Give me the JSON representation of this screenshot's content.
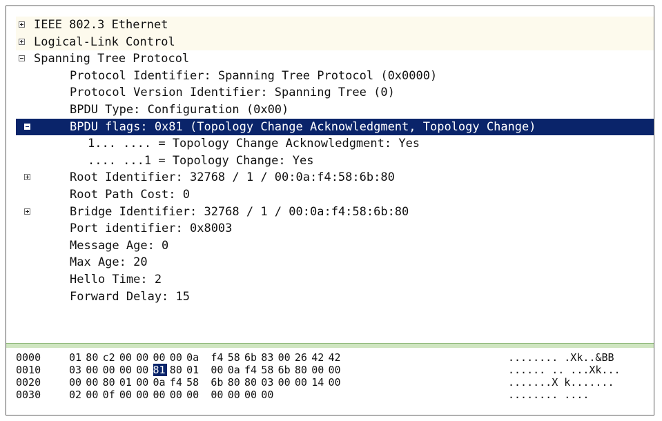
{
  "tree": [
    {
      "text": "IEEE 802.3 Ethernet",
      "indent": 0,
      "toggle": "plus",
      "style": "cream"
    },
    {
      "text": "Logical-Link Control",
      "indent": 0,
      "toggle": "plus",
      "style": "cream"
    },
    {
      "text": "Spanning Tree Protocol",
      "indent": 0,
      "toggle": "minus",
      "style": ""
    },
    {
      "text": "Protocol Identifier: Spanning Tree Protocol (0x0000)",
      "indent": 1,
      "toggle": "",
      "style": ""
    },
    {
      "text": "Protocol Version Identifier: Spanning Tree (0)",
      "indent": 1,
      "toggle": "",
      "style": ""
    },
    {
      "text": "BPDU Type: Configuration (0x00)",
      "indent": 1,
      "toggle": "",
      "style": ""
    },
    {
      "text": "BPDU flags: 0x81 (Topology Change Acknowledgment, Topology Change)",
      "indent": 1,
      "toggle": "minus",
      "style": "selected"
    },
    {
      "text": "1... .... = Topology Change Acknowledgment: Yes",
      "indent": 2,
      "toggle": "",
      "style": ""
    },
    {
      "text": ".... ...1 = Topology Change: Yes",
      "indent": 2,
      "toggle": "",
      "style": ""
    },
    {
      "text": "Root Identifier: 32768 / 1 / 00:0a:f4:58:6b:80",
      "indent": 1,
      "toggle": "plus",
      "style": ""
    },
    {
      "text": "Root Path Cost: 0",
      "indent": 1,
      "toggle": "",
      "style": ""
    },
    {
      "text": "Bridge Identifier: 32768 / 1 / 00:0a:f4:58:6b:80",
      "indent": 1,
      "toggle": "plus",
      "style": ""
    },
    {
      "text": "Port identifier: 0x8003",
      "indent": 1,
      "toggle": "",
      "style": ""
    },
    {
      "text": "Message Age: 0",
      "indent": 1,
      "toggle": "",
      "style": ""
    },
    {
      "text": "Max Age: 20",
      "indent": 1,
      "toggle": "",
      "style": ""
    },
    {
      "text": "Hello Time: 2",
      "indent": 1,
      "toggle": "",
      "style": ""
    },
    {
      "text": "Forward Delay: 15",
      "indent": 1,
      "toggle": "",
      "style": ""
    }
  ],
  "hex": [
    {
      "offset": "0000",
      "bytes": [
        "01",
        "80",
        "c2",
        "00",
        "00",
        "00",
        "00",
        "0a",
        "f4",
        "58",
        "6b",
        "83",
        "00",
        "26",
        "42",
        "42"
      ],
      "ascii": "........ .Xk..&BB",
      "sel": -1
    },
    {
      "offset": "0010",
      "bytes": [
        "03",
        "00",
        "00",
        "00",
        "00",
        "81",
        "80",
        "01",
        "00",
        "0a",
        "f4",
        "58",
        "6b",
        "80",
        "00",
        "00"
      ],
      "ascii": "...... .. ...Xk...",
      "sel": 5
    },
    {
      "offset": "0020",
      "bytes": [
        "00",
        "00",
        "80",
        "01",
        "00",
        "0a",
        "f4",
        "58",
        "6b",
        "80",
        "80",
        "03",
        "00",
        "00",
        "14",
        "00"
      ],
      "ascii": ".......X k.......",
      "sel": -1
    },
    {
      "offset": "0030",
      "bytes": [
        "02",
        "00",
        "0f",
        "00",
        "00",
        "00",
        "00",
        "00",
        "00",
        "00",
        "00",
        "00"
      ],
      "ascii": "........ ....",
      "sel": -1
    }
  ],
  "colors": {
    "selection": "#0a246a",
    "cream_row": "#fdfaed",
    "divider": "#cfe5c0"
  }
}
